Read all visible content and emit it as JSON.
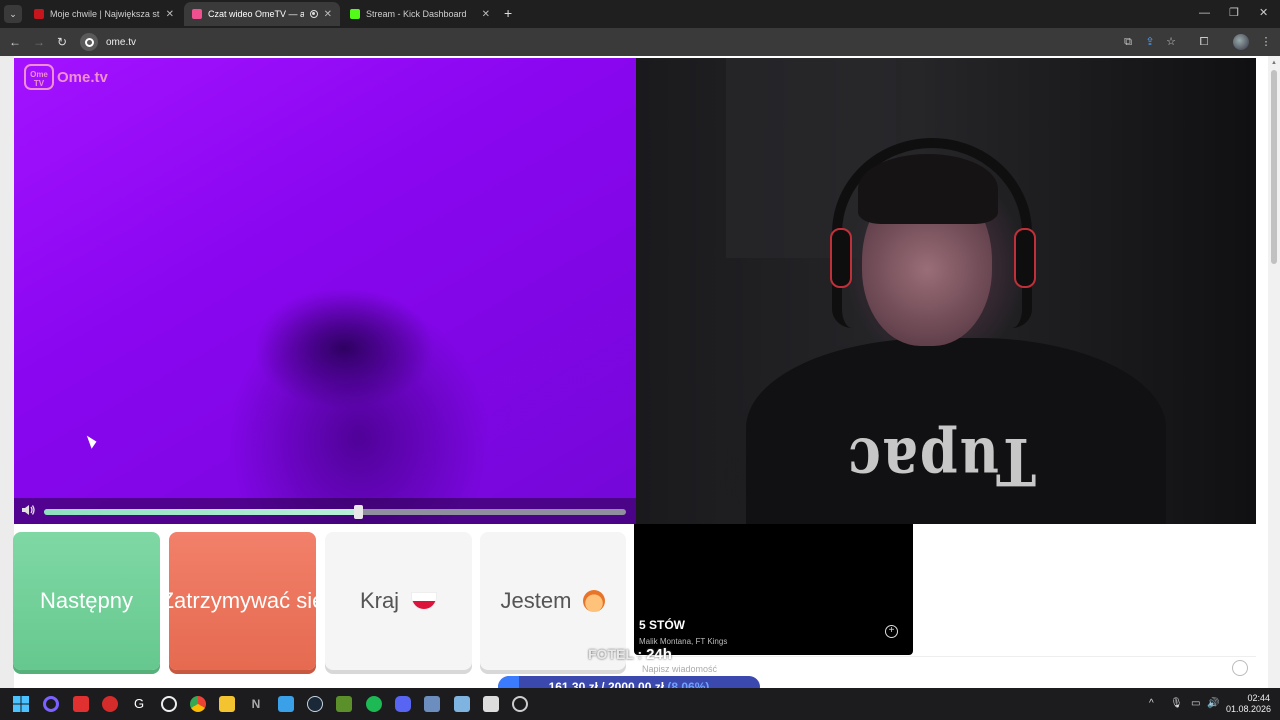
{
  "browser": {
    "tabs": [
      {
        "title": "Moje chwile | Największa strona",
        "favicon_color": "#c4161c"
      },
      {
        "title": "Czat wideo OmeTV — alter",
        "favicon_color": "#f05090"
      },
      {
        "title": "Stream - Kick Dashboard",
        "favicon_color": "#53fc18"
      }
    ],
    "new_tab": "+",
    "address": "ome.tv"
  },
  "page": {
    "logo": {
      "badge": "Ome TV",
      "text": "Ome.tv"
    },
    "volume": {
      "level": 0.54
    },
    "shirt_text": "Tupac",
    "buttons": {
      "next": "Następny",
      "stop": "Zatrzymywać się",
      "country": "Kraj",
      "me": "Jestem"
    },
    "music": {
      "title": "5 STÓW",
      "artist": "Malik Montana, FT Kings"
    },
    "chat": {
      "placeholder": "Napisz wiadomość"
    },
    "overlay": {
      "fotel_label": "FOTEL :",
      "fotel_value": "24h"
    },
    "donation": {
      "current": "161,30 zł",
      "separator": "/",
      "goal": "2000,00 zł",
      "percent": "(8.06%)",
      "progress": 0.0806
    }
  },
  "taskbar": {
    "time": "02:44",
    "date": "01.08.2026"
  },
  "colors": {
    "next_button": "#6dcf96",
    "stop_button": "#ec7459",
    "remote_video": "#8a06f0",
    "logo": "#f08fd0"
  }
}
